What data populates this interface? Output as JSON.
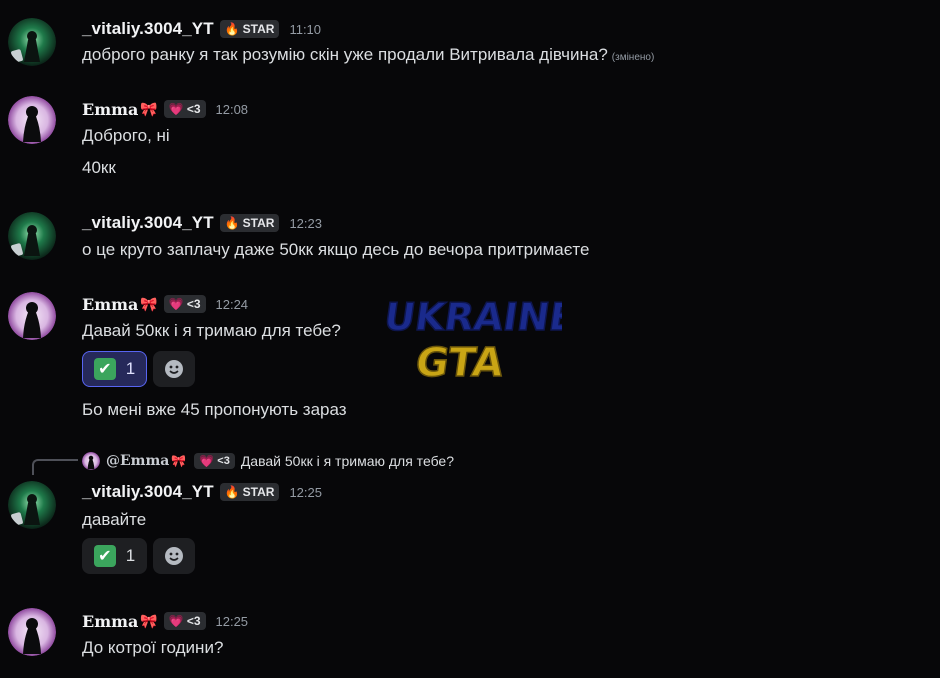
{
  "users": {
    "vitaliy": {
      "name": "_vitaliy.3004_YT",
      "tag_icon": "fire-icon",
      "tag": "STAR"
    },
    "emma": {
      "name": "Emma",
      "bow_icon": "ribbon-icon",
      "tag_icon": "heart-icon",
      "tag": "<3"
    }
  },
  "messages": [
    {
      "author": "_vitaliy.3004_YT",
      "tag": "STAR",
      "time": "11:10",
      "lines": [
        "доброго ранку я так розумію скін уже продали Витривала дівчина?"
      ],
      "edited": "(змінено)"
    },
    {
      "author": "Emma",
      "tag": "<3",
      "time": "12:08",
      "lines": [
        "Доброго, ні",
        "40кк"
      ]
    },
    {
      "author": "_vitaliy.3004_YT",
      "tag": "STAR",
      "time": "12:23",
      "lines": [
        "о це круто заплачу даже 50кк якщо десь до вечора притримаєте"
      ]
    },
    {
      "author": "Emma",
      "tag": "<3",
      "time": "12:24",
      "lines": [
        "Давай 50кк і я тримаю для тебе?",
        "Бо мені вже 45 пропонують зараз"
      ],
      "reaction": {
        "emoji": "✔",
        "count": "1",
        "active": true
      }
    },
    {
      "author": "_vitaliy.3004_YT",
      "tag": "STAR",
      "time": "12:25",
      "reply": {
        "to": "@Emma",
        "tag": "<3",
        "text": "Давай 50кк і я тримаю для тебе?"
      },
      "lines": [
        "давайте"
      ],
      "reaction": {
        "emoji": "✔",
        "count": "1",
        "active": false
      }
    },
    {
      "author": "Emma",
      "tag": "<3",
      "time": "12:25",
      "lines": [
        "До котрої години?"
      ]
    }
  ],
  "watermark": {
    "line1": "UKRAINE",
    "line2": "GTA"
  },
  "colors": {
    "background": "#070709",
    "accent": "#5865f2",
    "check_green": "#3ba55d",
    "watermark_blue": "#1a2a8c",
    "watermark_yellow": "#e8c21a"
  }
}
